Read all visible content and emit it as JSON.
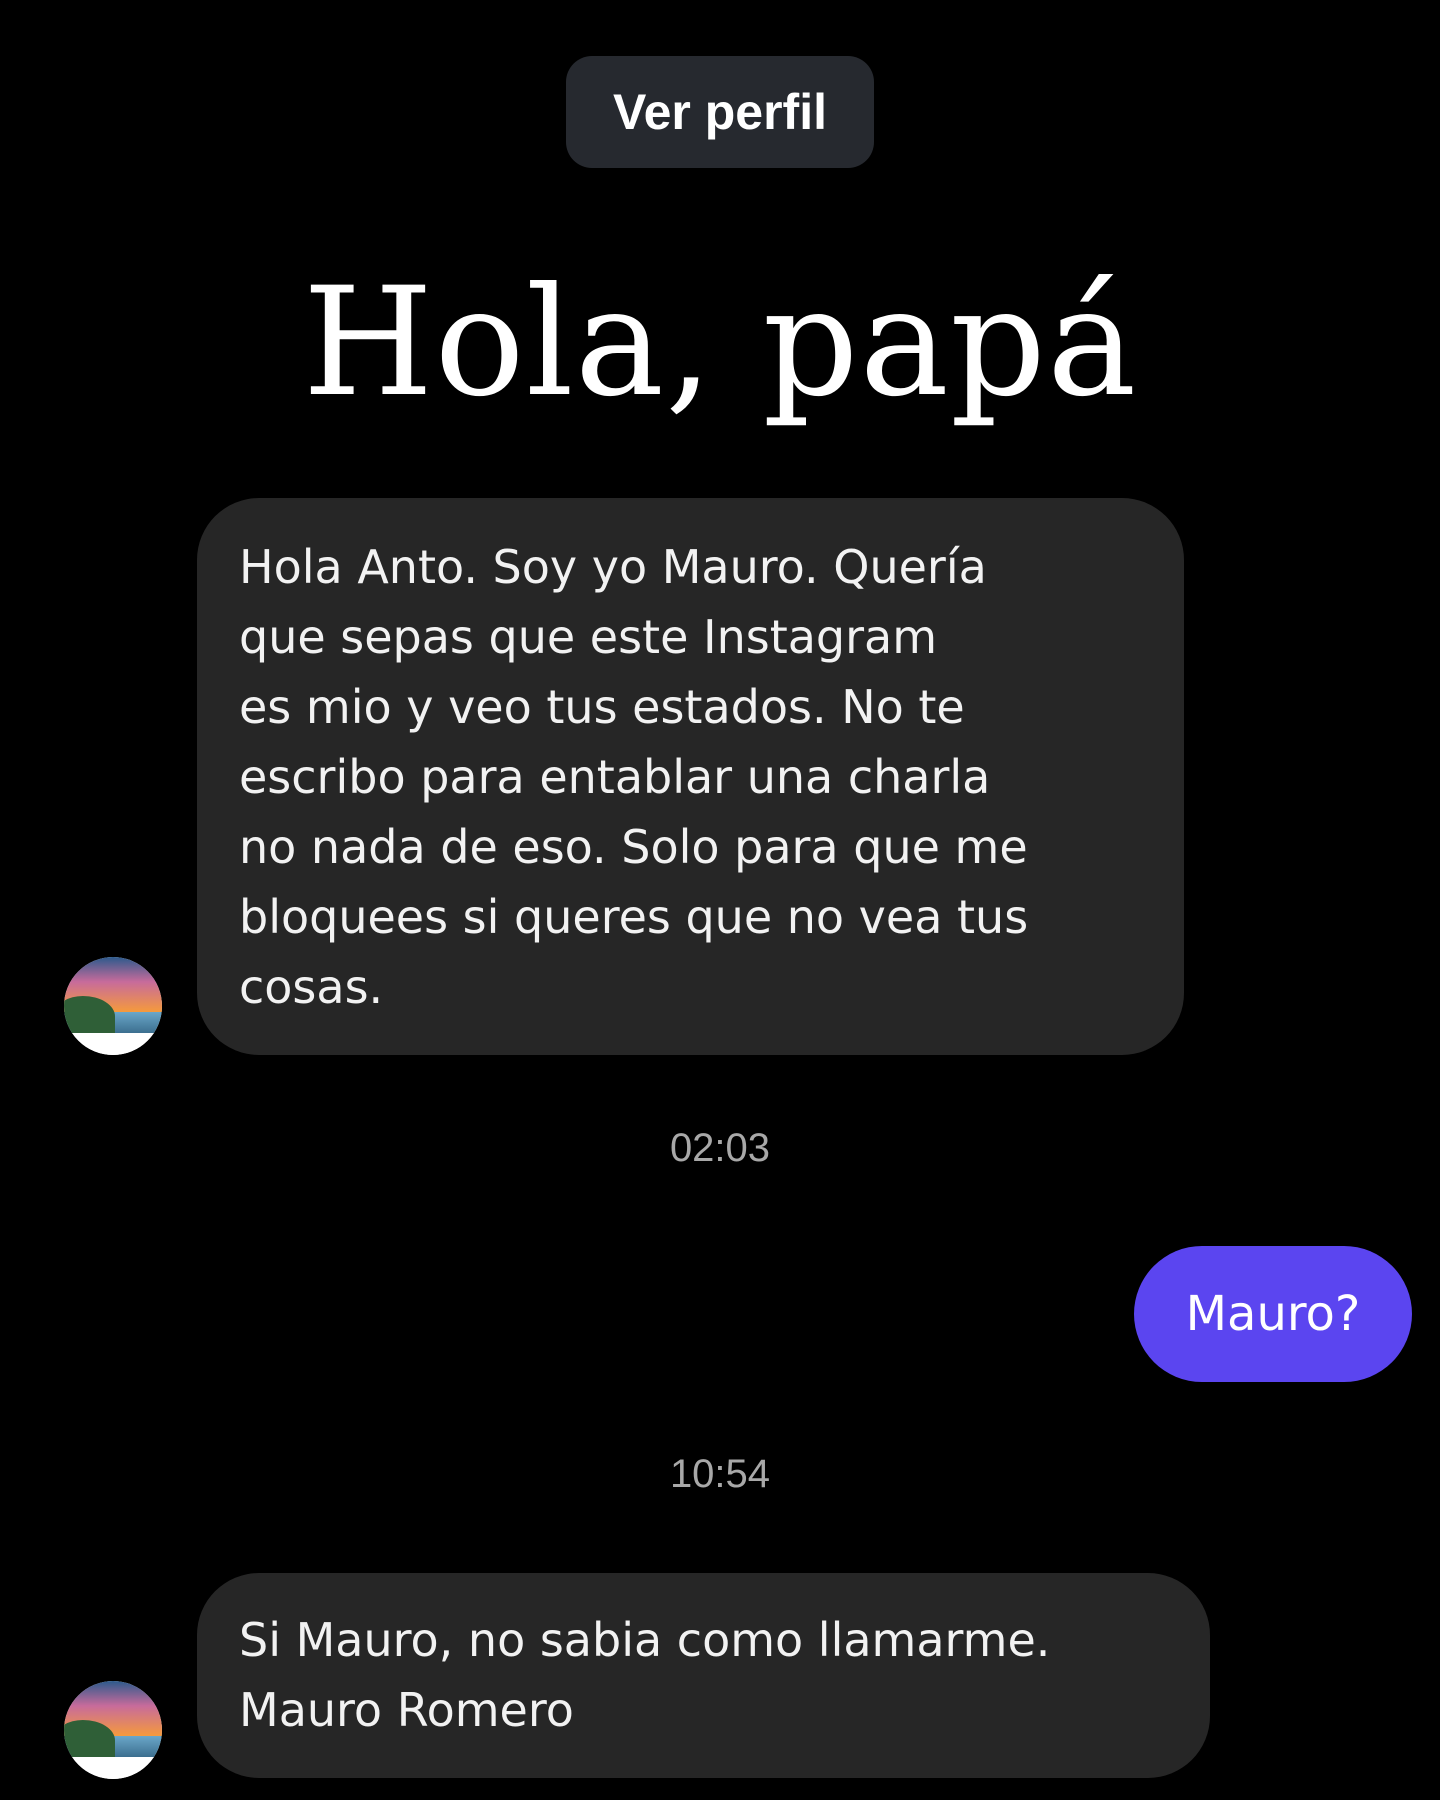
{
  "header": {
    "view_profile_label": "Ver perfil"
  },
  "heading": "Hola, papá",
  "messages": [
    {
      "direction": "incoming",
      "text": "Hola Anto. Soy yo Mauro. Quería\nque sepas que este Instagram\nes mio y veo tus estados. No te\nescribo para entablar una charla\nno nada de eso.  Solo para que me\nbloquees si queres que no vea tus\ncosas."
    },
    {
      "type": "timestamp",
      "text": "02:03"
    },
    {
      "direction": "outgoing",
      "text": "Mauro?"
    },
    {
      "type": "timestamp",
      "text": "10:54"
    },
    {
      "direction": "incoming",
      "text": "Si Mauro, no sabia como llamarme.\nMauro Romero"
    }
  ],
  "colors": {
    "background": "#000000",
    "incoming_bubble": "#262626",
    "outgoing_bubble": "#5b45f0",
    "button_bg": "#26292f",
    "timestamp": "#a8a8a8"
  },
  "icons": {
    "avatar": "landscape-avatar-icon"
  }
}
